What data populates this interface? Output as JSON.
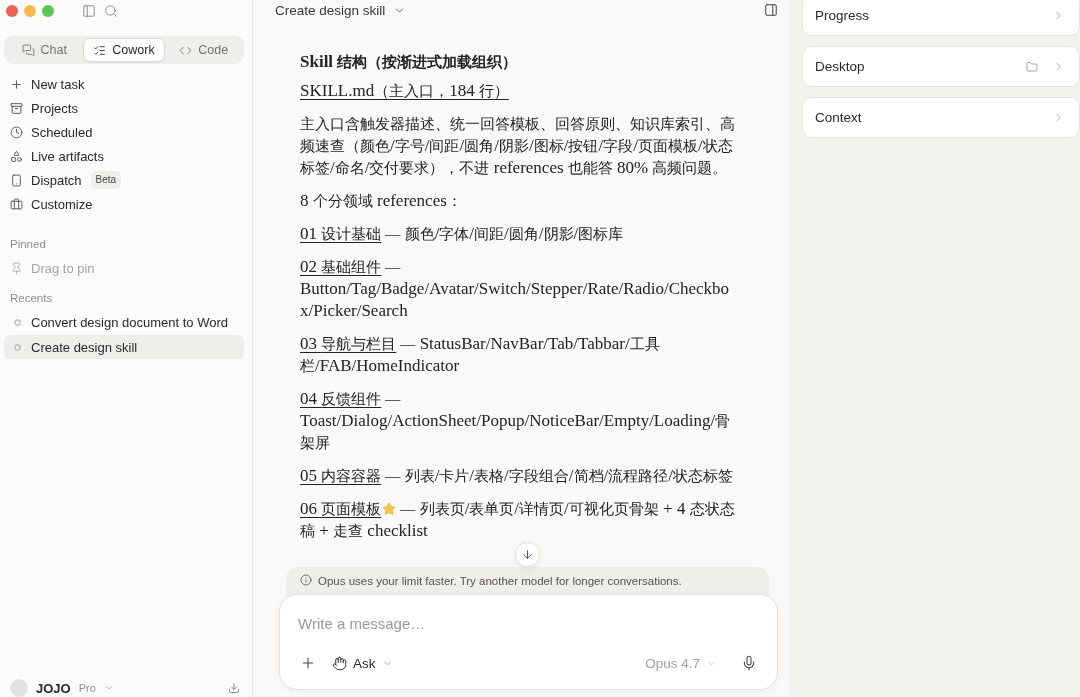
{
  "sidebar": {
    "mode_tabs": [
      {
        "label": "Chat",
        "selected": false
      },
      {
        "label": "Cowork",
        "selected": true
      },
      {
        "label": "Code",
        "selected": false
      }
    ],
    "nav_items": [
      {
        "label": "New task"
      },
      {
        "label": "Projects"
      },
      {
        "label": "Scheduled"
      },
      {
        "label": "Live artifacts"
      },
      {
        "label": "Dispatch",
        "badge": "Beta"
      },
      {
        "label": "Customize"
      }
    ],
    "pinned": {
      "heading": "Pinned",
      "hint": "Drag to pin"
    },
    "recents": {
      "heading": "Recents",
      "items": [
        {
          "label": "Convert design document to Word",
          "selected": false
        },
        {
          "label": "Create design skill",
          "selected": true
        }
      ]
    },
    "account": {
      "name": "JOJO",
      "plan": "Pro"
    }
  },
  "conversation": {
    "title": "Create design skill",
    "blocks": [
      {
        "kind": "heading",
        "text": "Skill 结构（按渐进式加载组织）"
      },
      {
        "kind": "link",
        "text": "SKILL.md（主入口，184 行）"
      },
      {
        "kind": "paragraph",
        "text": "主入口含触发器描述、统一回答模板、回答原则、知识库索引、高频速查（颜色/字号/间距/圆角/阴影/图标/按钮/字段/页面模板/状态标签/命名/交付要求），不进 references 也能答 80% 高频问题。"
      },
      {
        "kind": "paragraph",
        "text": "8 个分领域 references："
      },
      {
        "kind": "reference",
        "link": "01 设计基础",
        "starred": false,
        "text": "— 颜色/字体/间距/圆角/阴影/图标库"
      },
      {
        "kind": "reference",
        "link": "02 基础组件",
        "starred": false,
        "text": "— Button/Tag/Badge/Avatar/Switch/Stepper/Rate/Radio/Checkbox/Picker/Search"
      },
      {
        "kind": "reference",
        "link": "03 导航与栏目",
        "starred": false,
        "text": "— StatusBar/NavBar/Tab/Tabbar/工具栏/FAB/HomeIndicator"
      },
      {
        "kind": "reference",
        "link": "04 反馈组件",
        "starred": false,
        "text": "— Toast/Dialog/ActionSheet/Popup/NoticeBar/Empty/Loading/骨架屏"
      },
      {
        "kind": "reference",
        "link": "05 内容容器",
        "starred": false,
        "text": "— 列表/卡片/表格/字段组合/简档/流程路径/状态标签"
      },
      {
        "kind": "reference",
        "link": "06 页面模板",
        "starred": true,
        "text": "— 列表页/表单页/详情页/可视化页骨架 + 4 态状态稿 + 走查 checklist"
      }
    ]
  },
  "notice": {
    "text": "Opus uses your limit faster. Try another model for longer conversations."
  },
  "composer": {
    "placeholder": "Write a message…",
    "mode": "Ask",
    "model": "Opus 4.7"
  },
  "side_panel": {
    "cards": [
      {
        "label": "Progress",
        "kind": "plain"
      },
      {
        "label": "Desktop",
        "kind": "folder"
      },
      {
        "label": "Context",
        "kind": "plain"
      }
    ]
  }
}
